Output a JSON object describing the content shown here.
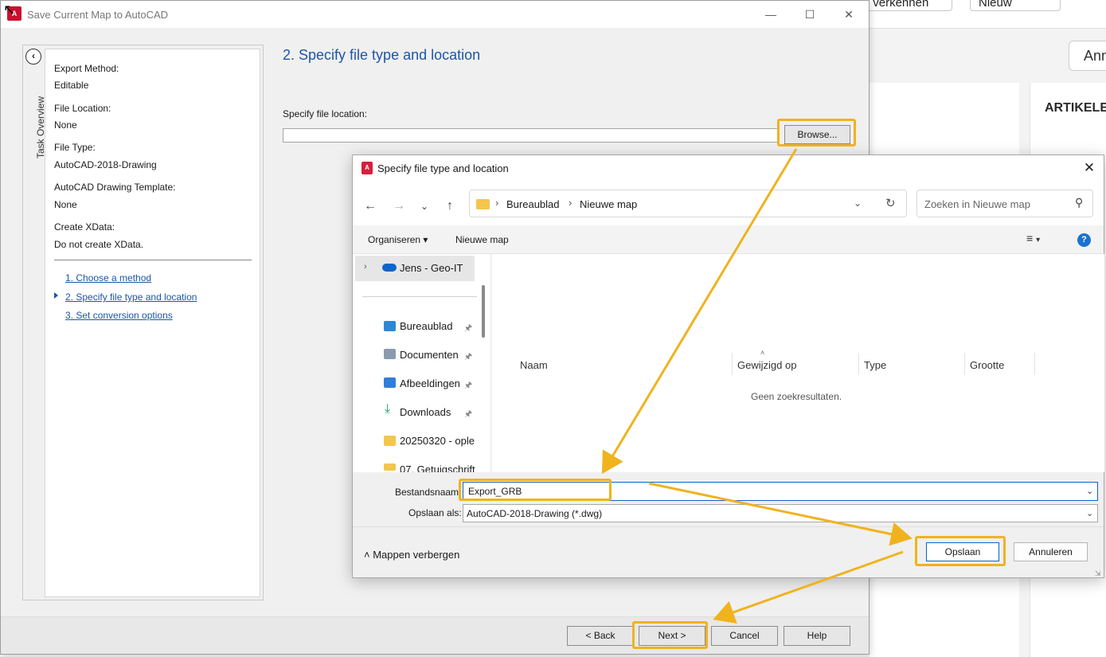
{
  "background": {
    "top_buttons": [
      "Abonnement verkennen",
      "Nieuw"
    ],
    "ann_button": "Ann",
    "section_title": "ARTIKELEI"
  },
  "main_dialog": {
    "title": "Save Current Map to AutoCAD",
    "title_icon": "autocad-logo-icon",
    "task_overview_label": "Task Overview",
    "info": [
      {
        "label": "Export Method:",
        "value": "Editable"
      },
      {
        "label": "File Location:",
        "value": "None"
      },
      {
        "label": "File Type:",
        "value": "AutoCAD-2018-Drawing"
      },
      {
        "label": "AutoCAD Drawing Template:",
        "value": "None"
      },
      {
        "label": "Create XData:",
        "value": "Do not create XData."
      }
    ],
    "steps": [
      "1. Choose a method",
      "2. Specify file type and location",
      "3. Set conversion options"
    ],
    "active_step": 1,
    "heading": "2. Specify file type and location",
    "file_location_label": "Specify file location:",
    "file_location_value": "",
    "browse_label": "Browse...",
    "footer_buttons": {
      "back": "< Back",
      "next": "Next >",
      "cancel": "Cancel",
      "help": "Help"
    }
  },
  "file_dialog": {
    "title": "Specify file type and location",
    "breadcrumb": [
      "Bureaublad",
      "Nieuwe map"
    ],
    "search_placeholder": "Zoeken in Nieuwe map",
    "toolbar": {
      "organize": "Organiseren",
      "new_folder": "Nieuwe map"
    },
    "nav_root": "Jens - Geo-IT",
    "nav_items": [
      {
        "label": "Bureaublad",
        "icon": "desktop-icon",
        "color": "#2b88d8",
        "pinned": true
      },
      {
        "label": "Documenten",
        "icon": "document-icon",
        "color": "#8a9bb0",
        "pinned": true
      },
      {
        "label": "Afbeeldingen",
        "icon": "image-icon",
        "color": "#2f7fd8",
        "pinned": true
      },
      {
        "label": "Downloads",
        "icon": "download-icon",
        "color": "#1f9d55",
        "pinned": true
      },
      {
        "label": "20250320 - ople",
        "icon": "folder-icon",
        "color": "#f3c64c",
        "pinned": false
      },
      {
        "label": "07. Getuigschrift",
        "icon": "folder-icon",
        "color": "#f3c64c",
        "pinned": false
      }
    ],
    "columns": [
      "Naam",
      "Gewijzigd op",
      "Type",
      "Grootte"
    ],
    "empty_message": "Geen zoekresultaten.",
    "filename_label": "Bestandsnaam:",
    "filename_value": "Export_GRB",
    "savetype_label": "Opslaan als:",
    "savetype_value": "AutoCAD-2018-Drawing (*.dwg)",
    "hide_folders": "Mappen verbergen",
    "save_label": "Opslaan",
    "cancel_label": "Annuleren"
  },
  "colors": {
    "highlight": "#f0b31e",
    "link": "#1d56a6",
    "accent": "#0a64c8"
  }
}
